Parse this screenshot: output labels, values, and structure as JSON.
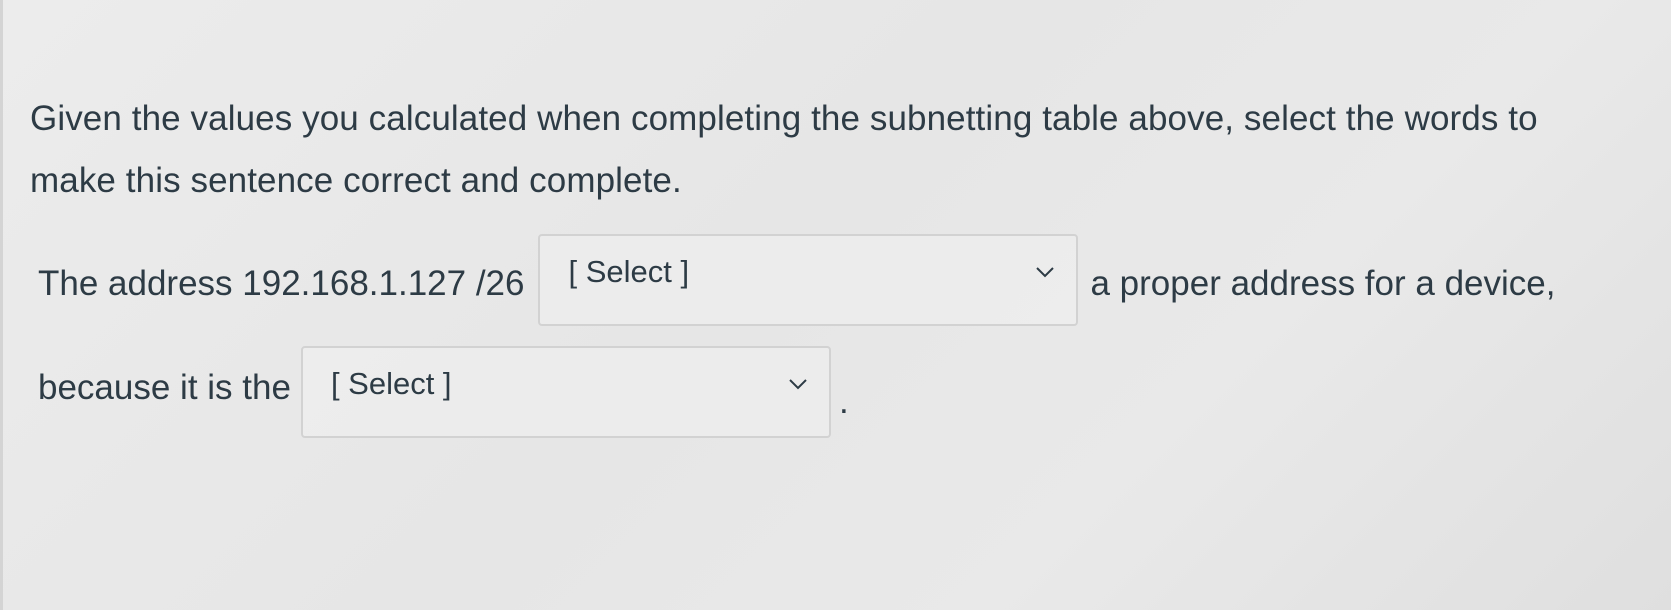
{
  "question": {
    "prompt": "Given the values you calculated when completing the subnetting table above, select the words to make this sentence correct and complete.",
    "line1_prefix": "The address 192.168.1.127 /26",
    "line1_suffix": "a proper address for a device,",
    "line2_prefix": "because it is the",
    "line2_suffix": "."
  },
  "dropdowns": [
    {
      "selected": "[ Select ]",
      "icon": "chevron-down-icon"
    },
    {
      "selected": "[ Select ]",
      "icon": "chevron-down-icon"
    }
  ],
  "colors": {
    "background": "#e8e8e8",
    "text": "#2d3b45",
    "border": "#d2d2d2"
  }
}
